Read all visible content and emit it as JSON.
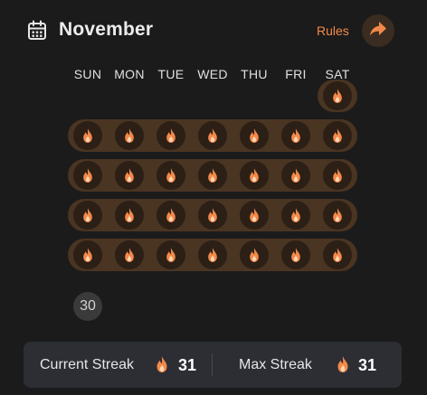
{
  "header": {
    "month": "November",
    "calendar_icon": "calendar-icon",
    "rules_label": "Rules",
    "share_icon": "share-arrow-icon",
    "accent": "#f2894a"
  },
  "weekdays": [
    "SUN",
    "MON",
    "TUE",
    "WED",
    "THU",
    "FRI",
    "SAT"
  ],
  "calendar": {
    "streak_icon": "flame-icon",
    "streak_weeks": [
      [
        6
      ],
      [
        0,
        1,
        2,
        3,
        4,
        5,
        6
      ],
      [
        0,
        1,
        2,
        3,
        4,
        5,
        6
      ],
      [
        0,
        1,
        2,
        3,
        4,
        5,
        6
      ],
      [
        0,
        1,
        2,
        3,
        4,
        5,
        6
      ]
    ],
    "last_day_label": "30",
    "colors": {
      "bar": "#4a3422",
      "cell": "#2b1f16",
      "flame": "#f2894a"
    }
  },
  "streaks": {
    "current_label": "Current Streak",
    "current_value": "31",
    "max_label": "Max Streak",
    "max_value": "31"
  }
}
